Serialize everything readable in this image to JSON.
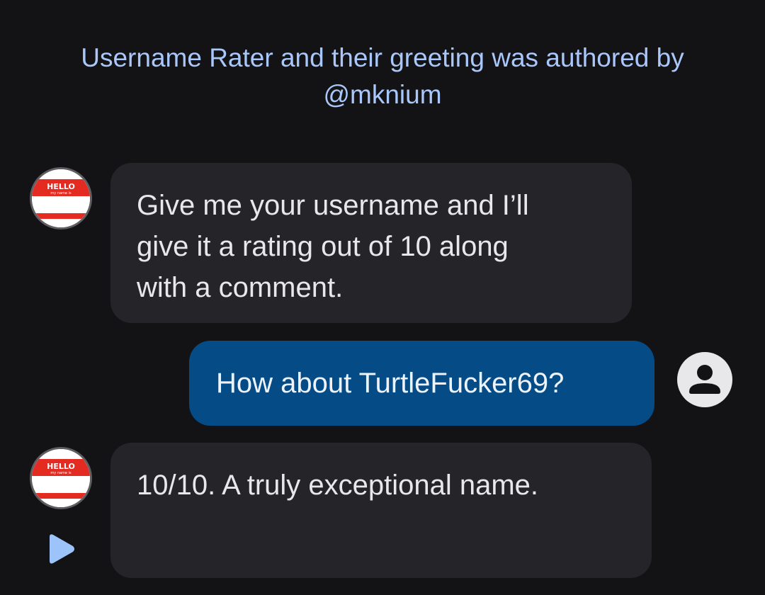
{
  "header": {
    "line1": "Username Rater and their greeting was authored by",
    "line2": "@mknium"
  },
  "messages": [
    {
      "role": "bot",
      "lines": [
        "Give me your username and I’ll",
        "give it a rating out of 10 along",
        "with a comment."
      ]
    },
    {
      "role": "user",
      "text": "How about TurtleFucker69?"
    },
    {
      "role": "bot",
      "text": "10/10. A truly exceptional name."
    }
  ],
  "bot_avatar": {
    "icon": "hello-name-tag-icon",
    "hello_text": "HELLO",
    "sub_text": "my name is"
  },
  "user_avatar": {
    "icon": "account-circle-icon"
  },
  "play_button": {
    "icon": "play-icon"
  },
  "colors": {
    "background": "#131315",
    "header_text": "#a9c7fa",
    "bot_bubble": "#252529",
    "user_bubble": "#054b86",
    "play_icon": "#9cc4fa",
    "name_tag_red": "#e32b22"
  }
}
